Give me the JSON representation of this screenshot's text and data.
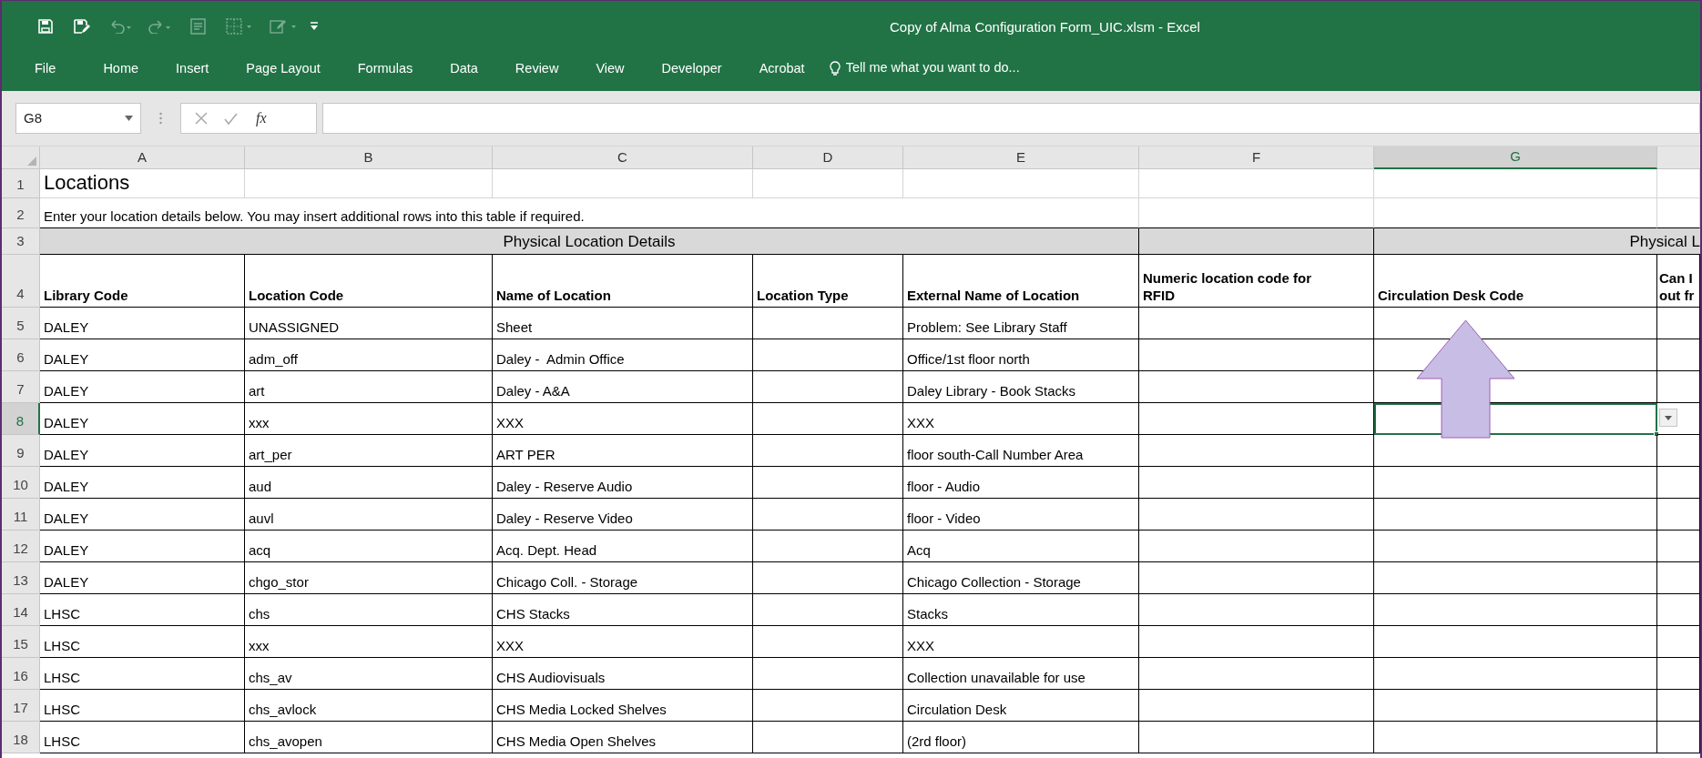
{
  "window": {
    "title": "Copy of Alma Configuration Form_UIC.xlsm - Excel"
  },
  "ribbon_tabs": [
    {
      "label": "File"
    },
    {
      "label": "Home"
    },
    {
      "label": "Insert"
    },
    {
      "label": "Page Layout"
    },
    {
      "label": "Formulas"
    },
    {
      "label": "Data"
    },
    {
      "label": "Review"
    },
    {
      "label": "View"
    },
    {
      "label": "Developer"
    },
    {
      "label": "Acrobat"
    }
  ],
  "tell_me": {
    "placeholder": "Tell me what you want to do..."
  },
  "formula_bar": {
    "name_box": "G8",
    "function_button": "fx"
  },
  "sheet": {
    "columns": [
      {
        "label": "A",
        "selected": false
      },
      {
        "label": "B",
        "selected": false
      },
      {
        "label": "C",
        "selected": false
      },
      {
        "label": "D",
        "selected": false
      },
      {
        "label": "E",
        "selected": false
      },
      {
        "label": "F",
        "selected": false
      },
      {
        "label": "G",
        "selected": true
      }
    ],
    "rows": [
      {
        "number": "1",
        "selected": false,
        "kind": "title",
        "text": "Locations"
      },
      {
        "number": "2",
        "selected": false,
        "kind": "note",
        "text": "Enter your location details below. You may insert additional rows into this table if required."
      },
      {
        "number": "3",
        "selected": false,
        "kind": "section",
        "texts": [
          "Physical Location Details",
          "Physical L"
        ]
      },
      {
        "number": "4",
        "selected": false,
        "kind": "header",
        "texts": [
          "Library Code",
          "Location Code",
          "Name of Location",
          "Location Type",
          "External Name of Location",
          "Numeric location code for RFID",
          "Circulation Desk Code",
          "Can I out fr"
        ]
      },
      {
        "number": "5",
        "selected": false,
        "kind": "data",
        "library_code": "DALEY",
        "location_code": "UNASSIGNED",
        "location_name": "Sheet",
        "external_name": "Problem: See Library Staff"
      },
      {
        "number": "6",
        "selected": false,
        "kind": "data",
        "library_code": "DALEY",
        "location_code": "adm_off",
        "location_name": "Daley -  Admin Office",
        "external_name": "Office/1st floor north"
      },
      {
        "number": "7",
        "selected": false,
        "kind": "data",
        "library_code": "DALEY",
        "location_code": "art",
        "location_name": "Daley - A&A",
        "external_name": "Daley Library - Book Stacks"
      },
      {
        "number": "8",
        "selected": true,
        "kind": "data",
        "library_code": "DALEY",
        "location_code": "xxx",
        "location_name": "XXX",
        "external_name": "XXX"
      },
      {
        "number": "9",
        "selected": false,
        "kind": "data",
        "library_code": "DALEY",
        "location_code": "art_per",
        "location_name": "ART PER",
        "external_name": "floor south-Call Number Area"
      },
      {
        "number": "10",
        "selected": false,
        "kind": "data",
        "library_code": "DALEY",
        "location_code": "aud",
        "location_name": "Daley - Reserve Audio",
        "external_name": "floor - Audio"
      },
      {
        "number": "11",
        "selected": false,
        "kind": "data",
        "library_code": "DALEY",
        "location_code": "auvl",
        "location_name": "Daley - Reserve Video",
        "external_name": "floor - Video"
      },
      {
        "number": "12",
        "selected": false,
        "kind": "data",
        "library_code": "DALEY",
        "location_code": "acq",
        "location_name": "Acq. Dept. Head",
        "external_name": "Acq"
      },
      {
        "number": "13",
        "selected": false,
        "kind": "data",
        "library_code": "DALEY",
        "location_code": "chgo_stor",
        "location_name": "Chicago Coll. - Storage",
        "external_name": "Chicago Collection - Storage"
      },
      {
        "number": "14",
        "selected": false,
        "kind": "data",
        "library_code": "LHSC",
        "location_code": "chs",
        "location_name": "CHS Stacks",
        "external_name": "Stacks"
      },
      {
        "number": "15",
        "selected": false,
        "kind": "data",
        "library_code": "LHSC",
        "location_code": "xxx",
        "location_name": "XXX",
        "external_name": "XXX"
      },
      {
        "number": "16",
        "selected": false,
        "kind": "data",
        "library_code": "LHSC",
        "location_code": "chs_av",
        "location_name": "CHS Audiovisuals",
        "external_name": "Collection unavailable for use"
      },
      {
        "number": "17",
        "selected": false,
        "kind": "data",
        "library_code": "LHSC",
        "location_code": "chs_avlock",
        "location_name": "CHS Media Locked Shelves",
        "external_name": "Circulation Desk"
      },
      {
        "number": "18",
        "selected": false,
        "kind": "data",
        "library_code": "LHSC",
        "location_code": "chs_avopen",
        "location_name": "CHS Media Open Shelves",
        "external_name": "(2rd floor)"
      }
    ]
  }
}
